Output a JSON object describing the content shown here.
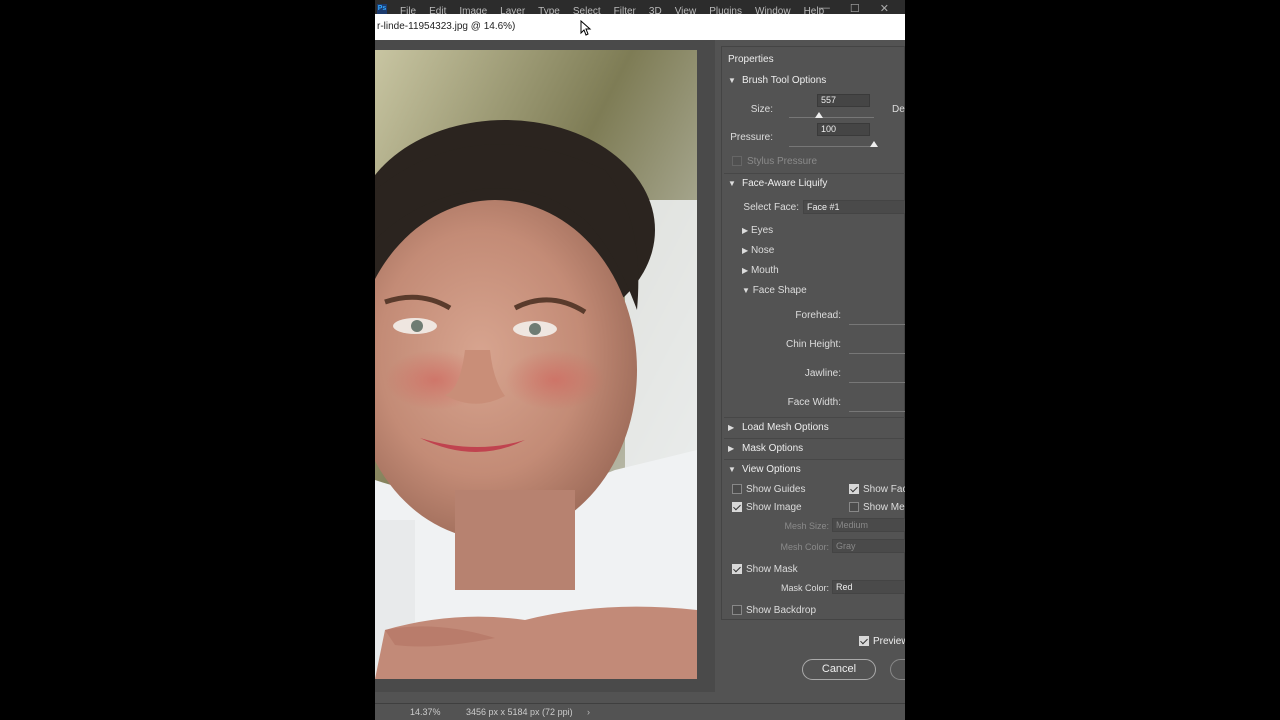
{
  "menu": [
    "File",
    "Edit",
    "Image",
    "Layer",
    "Type",
    "Select",
    "Filter",
    "3D",
    "View",
    "Plugins",
    "Window",
    "Help"
  ],
  "app_logo": "Ps",
  "window_controls": {
    "minimize": "—",
    "maximize": "☐",
    "close": "✕"
  },
  "title": "r-linde-11954323.jpg @ 14.6%)",
  "status": {
    "zoom": "14.37%",
    "doc_size": "3456 px x 5184 px (72 ppi)",
    "arrow": "›"
  },
  "properties": {
    "title": "Properties",
    "brush": {
      "header": "Brush Tool Options",
      "size_label": "Size:",
      "size_value": "557",
      "size_level": 0.35,
      "density_label": "De",
      "pressure_label": "Pressure:",
      "pressure_value": "100",
      "pressure_level": 1.0,
      "stylus_label": "Stylus Pressure"
    },
    "face": {
      "header": "Face-Aware Liquify",
      "select_face_label": "Select Face:",
      "select_face_value": "Face #1",
      "eyes": "Eyes",
      "nose": "Nose",
      "mouth": "Mouth",
      "face_shape": "Face Shape",
      "forehead": "Forehead:",
      "chin_height": "Chin Height:",
      "jawline": "Jawline:",
      "face_width": "Face Width:"
    },
    "load_mesh": "Load Mesh Options",
    "mask_options": "Mask Options",
    "view": {
      "header": "View Options",
      "show_guides": "Show Guides",
      "show_face": "Show Face",
      "show_image": "Show Image",
      "show_mesh": "Show Mesh",
      "mesh_size_label": "Mesh Size:",
      "mesh_size_value": "Medium",
      "mesh_color_label": "Mesh Color:",
      "mesh_color_value": "Gray",
      "show_mask": "Show Mask",
      "mask_color_label": "Mask Color:",
      "mask_color_value": "Red",
      "show_backdrop": "Show Backdrop"
    },
    "preview": "Preview",
    "cancel": "Cancel"
  }
}
